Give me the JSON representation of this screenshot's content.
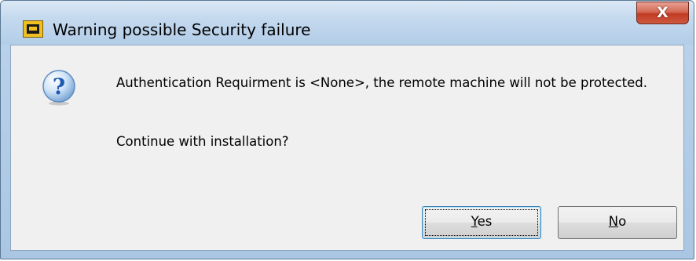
{
  "window": {
    "title": "Warning possible Security failure",
    "close_glyph": "X",
    "app_icon": "application-icon"
  },
  "dialog": {
    "icon": "question-icon",
    "message": "Authentication Requirment is <None>, the remote machine will not be protected.",
    "question": "Continue with installation?"
  },
  "buttons": {
    "yes": {
      "mnemonic": "Y",
      "rest": "es",
      "default": true
    },
    "no": {
      "mnemonic": "N",
      "rest": "o",
      "default": false
    }
  },
  "colors": {
    "close_button": "#c03a24",
    "question_icon": "#2d6fc4",
    "client_bg": "#f0f0f0"
  }
}
